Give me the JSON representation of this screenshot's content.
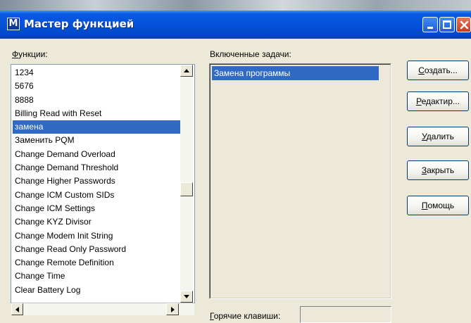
{
  "window": {
    "app_icon_letter": "M",
    "title": "Мастер функцией"
  },
  "functions": {
    "label_accel": "Ф",
    "label_rest": "ункции:",
    "items": [
      "1234",
      "5676",
      "8888",
      "Billing Read with Reset",
      "замена",
      "Заменить PQM",
      "Change Demand Overload",
      "Change Demand Threshold",
      "Change Higher Passwords",
      "Change ICM Custom SIDs",
      "Change ICM Settings",
      "Change KYZ Divisor",
      "Change Modem Init String",
      "Change Read Only Password",
      "Change Remote Definition",
      "Change Time",
      "Clear Battery Log"
    ],
    "selected_item": "замена"
  },
  "tasks": {
    "label": "Включенные задачи:",
    "items": [
      "Замена программы"
    ]
  },
  "hotkeys": {
    "label_accel": "Г",
    "label_rest": "орячие клавиши:",
    "value": ""
  },
  "buttons": {
    "create": {
      "accel": "С",
      "rest": "оздать..."
    },
    "edit": {
      "accel": "Р",
      "rest": "едактир..."
    },
    "delete": {
      "accel": "У",
      "rest": "далить"
    },
    "close": {
      "accel": "З",
      "rest": "акрыть"
    },
    "help": {
      "accel": "П",
      "rest": "омощь"
    }
  }
}
